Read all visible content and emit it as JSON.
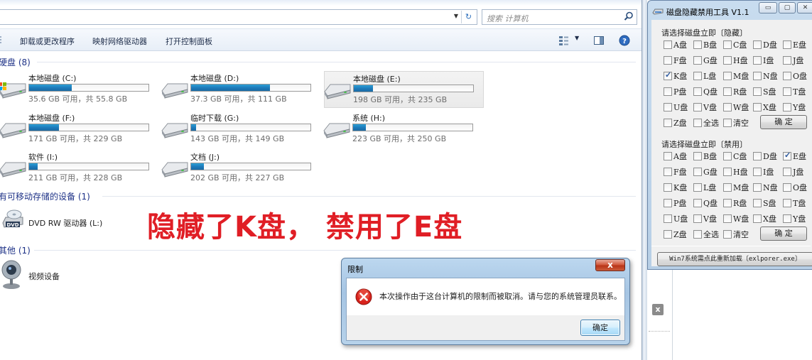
{
  "explorer": {
    "search_placeholder": "搜索 计算机",
    "toolbar": {
      "uninstall": "卸载或更改程序",
      "map_drive": "映射网络驱动器",
      "control_panel": "打开控制面板"
    },
    "groups": {
      "hdd": "硬盘 (8)",
      "removable": "有可移动存储的设备 (1)",
      "other": "其他 (1)"
    },
    "drives": [
      {
        "name": "本地磁盘 (C:)",
        "info": "35.6 GB 可用，共 55.8 GB",
        "used_fraction": 0.36
      },
      {
        "name": "本地磁盘 (D:)",
        "info": "37.3 GB 可用，共 111 GB",
        "used_fraction": 0.66
      },
      {
        "name": "本地磁盘 (E:)",
        "info": "198 GB 可用，共 235 GB",
        "used_fraction": 0.16
      },
      {
        "name": "本地磁盘 (F:)",
        "info": "171 GB 可用，共 229 GB",
        "used_fraction": 0.25
      },
      {
        "name": "临时下载 (G:)",
        "info": "143 GB 可用，共 149 GB",
        "used_fraction": 0.04
      },
      {
        "name": "系统 (H:)",
        "info": "223 GB 可用，共 250 GB",
        "used_fraction": 0.11
      },
      {
        "name": "软件 (I:)",
        "info": "211 GB 可用，共 228 GB",
        "used_fraction": 0.07
      },
      {
        "name": "文档 (J:)",
        "info": "202 GB 可用，共 227 GB",
        "used_fraction": 0.11
      }
    ],
    "dvd_label": "DVD RW 驱动器 (L:)",
    "dvd_badge": "DVD",
    "video_label": "视频设备"
  },
  "annotation": "隐藏了K盘， 禁用了E盘",
  "dialog": {
    "title": "限制",
    "close": "x",
    "message": "本次操作由于这台计算机的限制而被取消。请与您的系统管理员联系。",
    "ok": "确定"
  },
  "mid": {
    "close": "x"
  },
  "tool": {
    "title": "磁盘隐藏禁用工具 V1.1",
    "hide_label": "请选择磁盘立即〔隐藏〕",
    "disable_label": "请选择磁盘立即〔禁用〕",
    "drive_rows": [
      [
        "A盘",
        "B盘",
        "C盘",
        "D盘",
        "E盘"
      ],
      [
        "F盘",
        "G盘",
        "H盘",
        "I盘",
        "J盘"
      ],
      [
        "K盘",
        "L盘",
        "M盘",
        "N盘",
        "O盘"
      ],
      [
        "P盘",
        "Q盘",
        "R盘",
        "S盘",
        "T盘"
      ],
      [
        "U盘",
        "V盘",
        "W盘",
        "X盘",
        "Y盘"
      ]
    ],
    "z_label": "Z盘",
    "all_label": "全选",
    "clear_label": "清空",
    "confirm": "确 定",
    "hidden_checked": [
      "K盘"
    ],
    "disabled_checked": [
      "E盘"
    ],
    "reload": "Win7系统需点此重新加载〔exlporer.exe〕"
  },
  "colors": {
    "annotation": "#e01e25",
    "group_header": "#1e3287",
    "drive_bar": "#1d79b8",
    "dialog_frame": "#a6c5e3"
  }
}
